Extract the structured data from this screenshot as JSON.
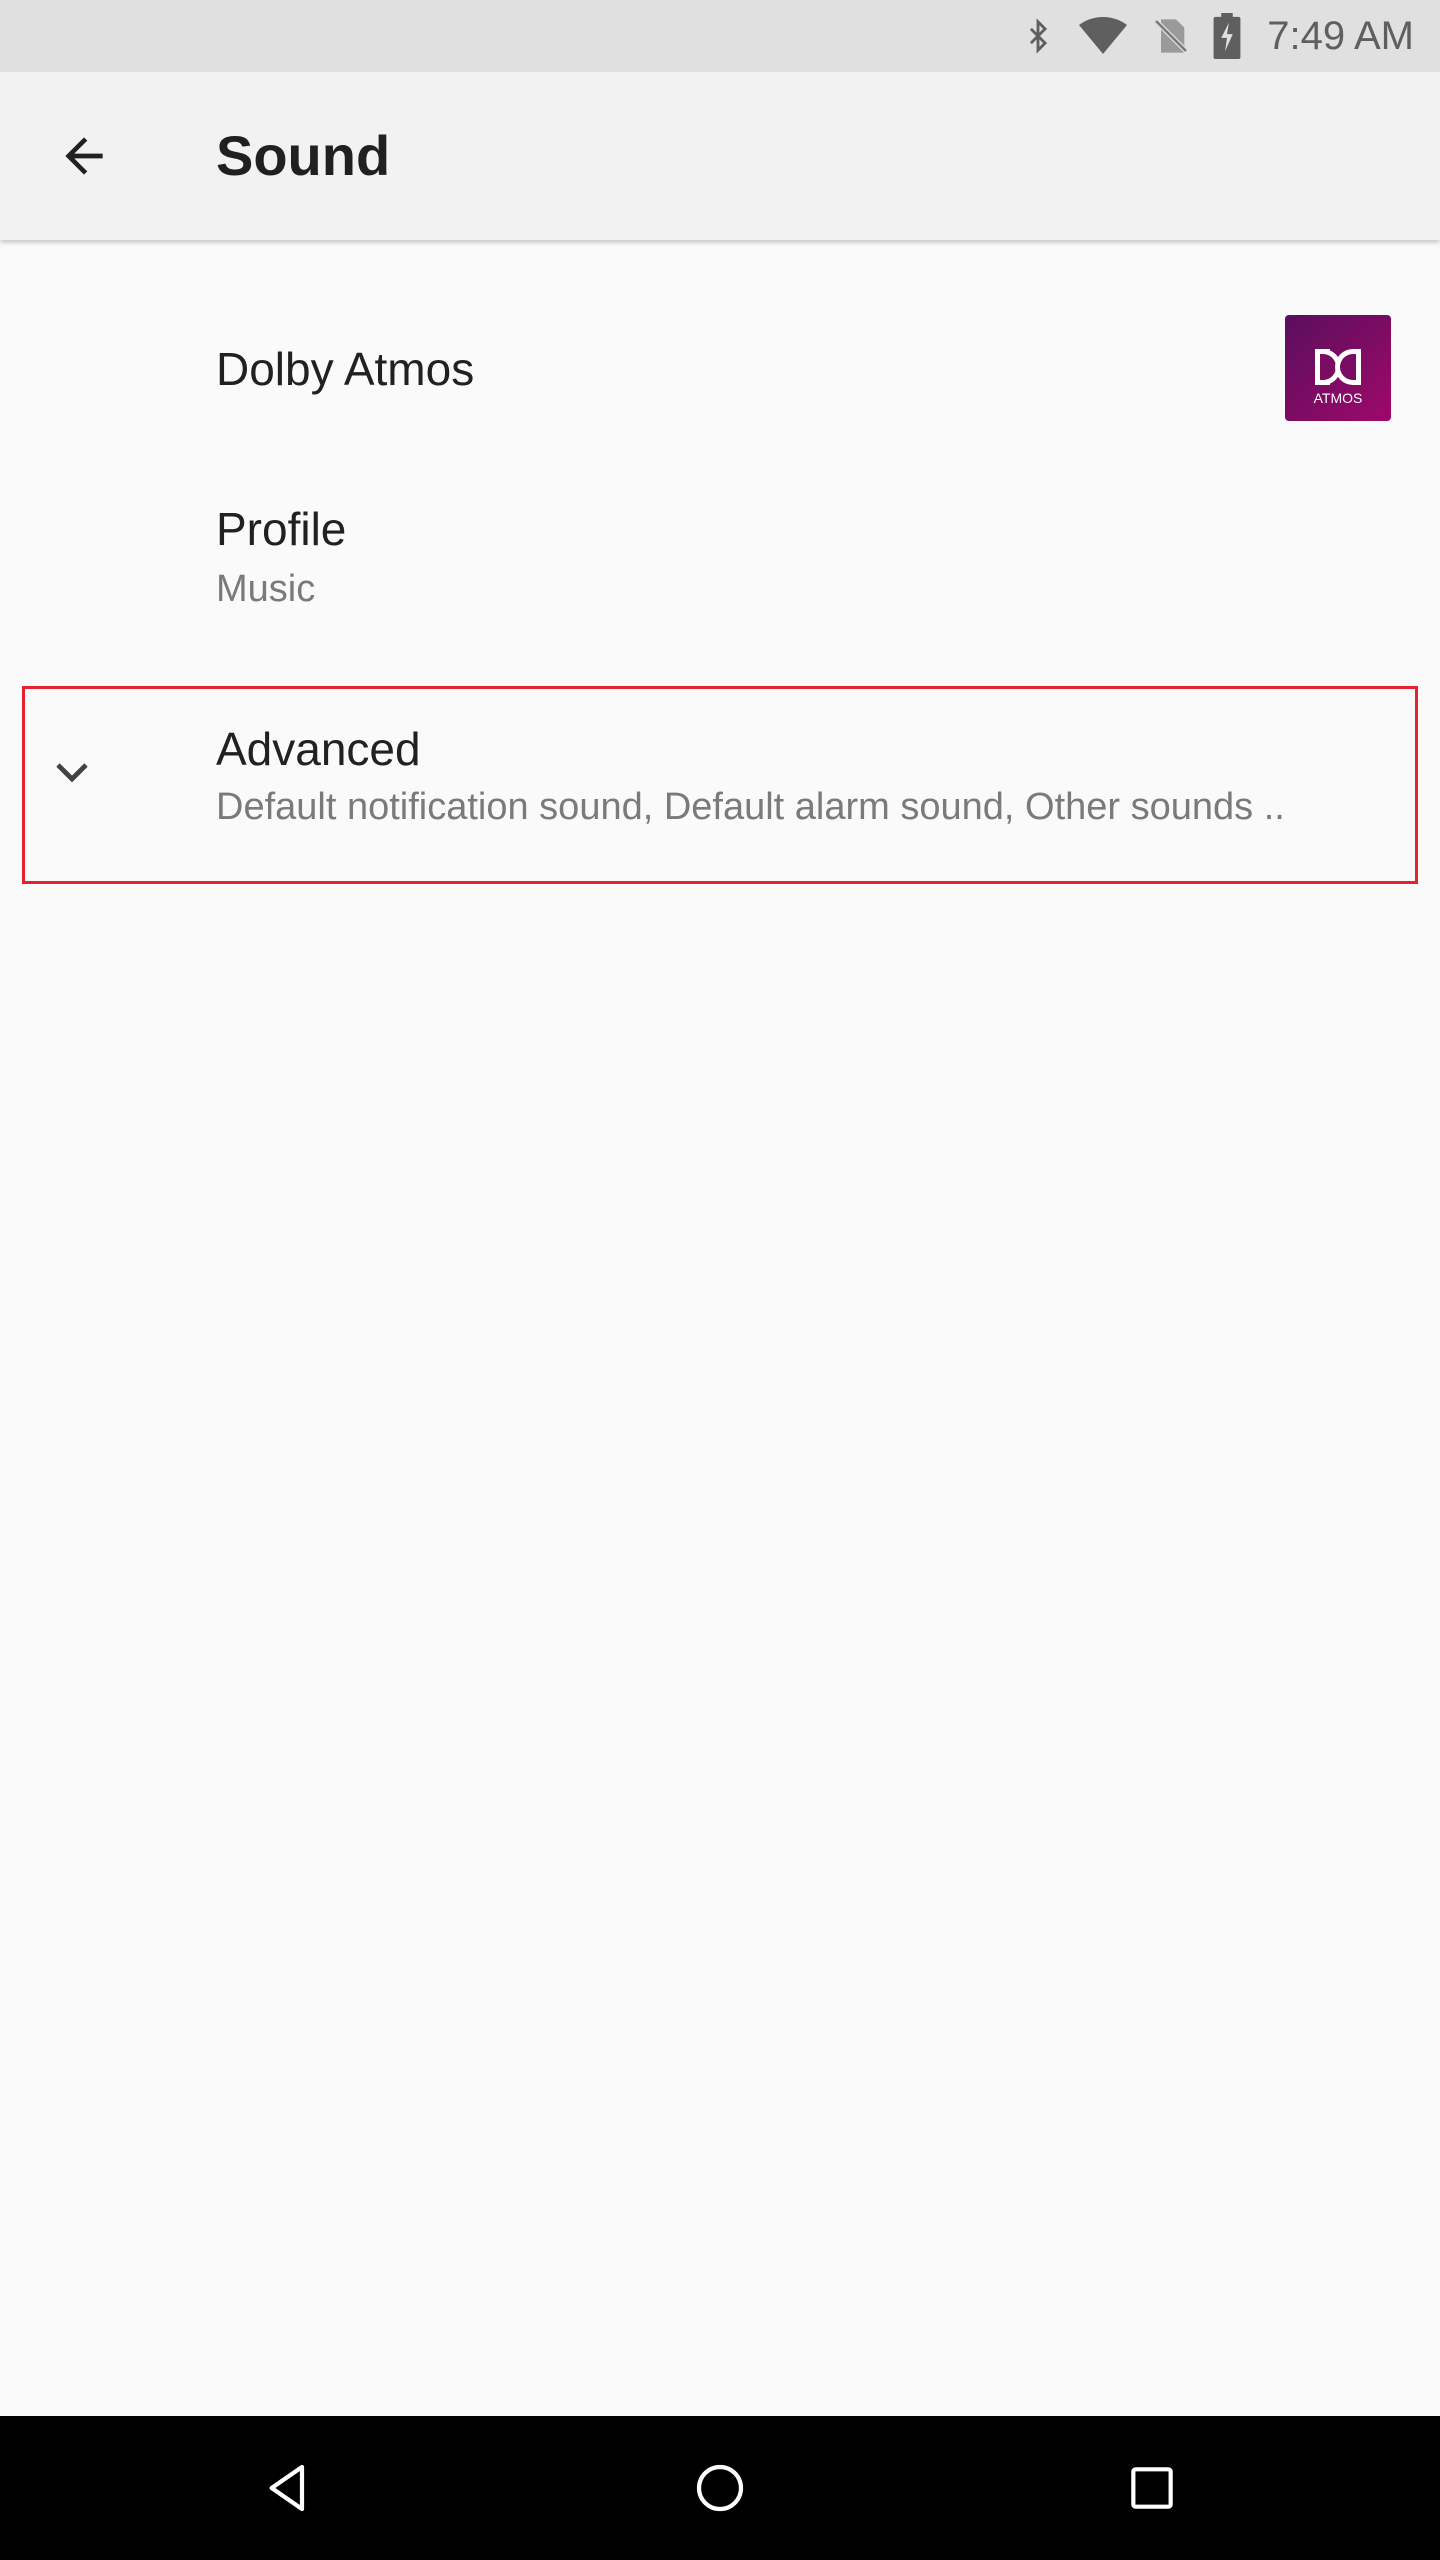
{
  "status_bar": {
    "time": "7:49 AM",
    "icons": [
      "bluetooth-icon",
      "wifi-icon",
      "no-sim-icon",
      "battery-charging-icon"
    ]
  },
  "app_bar": {
    "back_icon": "arrow-back-icon",
    "title": "Sound"
  },
  "preferences": [
    {
      "title": "Dolby Atmos",
      "summary": "",
      "icon": "dolby-atmos-logo",
      "logo_text": "ATMOS"
    },
    {
      "title": "Profile",
      "summary": "Music"
    },
    {
      "title": "Advanced",
      "summary": "Default notification sound, Default alarm sound, Other sounds ..",
      "icon": "chevron-down-icon"
    }
  ],
  "nav_bar": {
    "icons": [
      "back-triangle-icon",
      "home-circle-icon",
      "recents-square-icon"
    ]
  },
  "colors": {
    "highlight": "#e32430",
    "dolby_logo": "#7b0c63",
    "status_bar": "#e0e0e0",
    "nav_bar": "#000000"
  }
}
